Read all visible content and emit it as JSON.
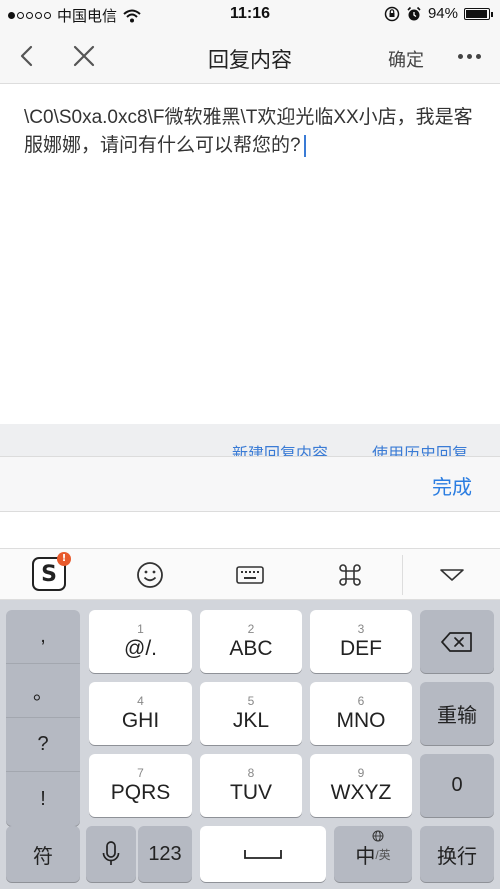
{
  "status_bar": {
    "carrier": "中国电信",
    "time": "11:16",
    "battery": "94%",
    "battery_level": 0.94,
    "signal_bars_on": 1,
    "signal_bars_total": 5
  },
  "nav": {
    "title": "回复内容",
    "confirm_label": "确定"
  },
  "content": {
    "reply_text": "\\C0\\S0xa.0xc8\\F微软雅黑\\T欢迎光临XX小店，我是客服娜娜，请问有什么可以帮您的?"
  },
  "links": {
    "new_reply": "新建回复内容",
    "history_reply": "使用历史回复"
  },
  "done_bar": {
    "done_label": "完成"
  },
  "keyboard": {
    "punctuation": [
      ",",
      "。",
      "?",
      "!"
    ],
    "keys": [
      {
        "num": "1",
        "letters": "@/."
      },
      {
        "num": "2",
        "letters": "ABC"
      },
      {
        "num": "3",
        "letters": "DEF"
      },
      {
        "num": "4",
        "letters": "GHI"
      },
      {
        "num": "5",
        "letters": "JKL"
      },
      {
        "num": "6",
        "letters": "MNO"
      },
      {
        "num": "7",
        "letters": "PQRS"
      },
      {
        "num": "8",
        "letters": "TUV"
      },
      {
        "num": "9",
        "letters": "WXYZ"
      }
    ],
    "retype_label": "重输",
    "zero_label": "0",
    "symbol_label": "符",
    "num_label": "123",
    "lang_label": "中",
    "lang_sub_label": "/英",
    "enter_label": "换行",
    "sogou_badge": "!"
  },
  "icons": {
    "back": "chevron-left-icon",
    "close": "close-icon",
    "more": "more-icon",
    "sogou": "sogou-logo",
    "emoji": "emoji-icon",
    "keyboard": "keyboard-icon",
    "command": "command-icon",
    "collapse": "collapse-down-icon",
    "delete": "backspace-icon",
    "mic": "microphone-icon",
    "space": "space-icon",
    "globe": "globe-icon"
  },
  "colors": {
    "accent": "#2b7de1",
    "link": "#3a7bd5",
    "key_dark": "#b5b9c2",
    "keyboard_bg": "#d2d5db"
  }
}
